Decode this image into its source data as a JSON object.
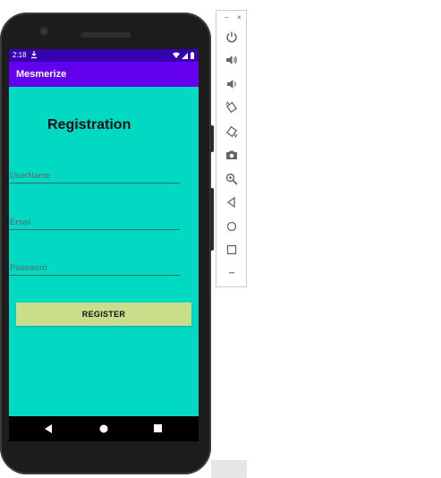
{
  "status_bar": {
    "time": "2:18"
  },
  "app_bar": {
    "title": "Mesmerize"
  },
  "form": {
    "heading": "Registration",
    "username_placeholder": "UserName",
    "email_placeholder": "Email",
    "password_placeholder": "Password",
    "register_label": "REGISTER"
  },
  "toolbar": {
    "minimize_glyph": "−",
    "close_glyph": "×",
    "more_glyph": "•••",
    "icons": [
      "power-icon",
      "volume-up-icon",
      "volume-down-icon",
      "rotate-left-icon",
      "rotate-right-icon",
      "camera-icon",
      "zoom-icon",
      "back-icon",
      "home-icon",
      "overview-icon",
      "more-icon"
    ]
  },
  "colors": {
    "status_bar": "#3700b3",
    "app_bar": "#6200ee",
    "background": "#02d9c3",
    "button": "#c9dd8b"
  }
}
